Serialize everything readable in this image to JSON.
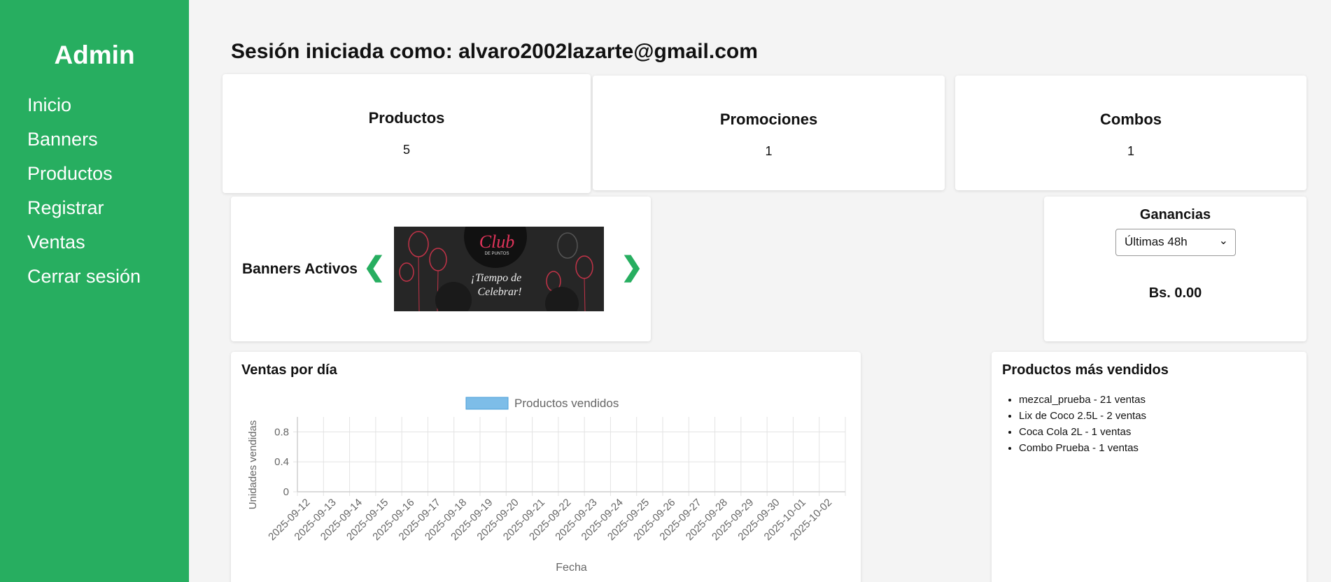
{
  "sidebar": {
    "brand": "Admin",
    "items": [
      {
        "label": "Inicio"
      },
      {
        "label": "Banners"
      },
      {
        "label": "Productos"
      },
      {
        "label": "Registrar"
      },
      {
        "label": "Ventas"
      },
      {
        "label": "Cerrar sesión"
      }
    ]
  },
  "header": {
    "title": "Sesión iniciada como: alvaro2002lazarte@gmail.com"
  },
  "stats": [
    {
      "title": "Productos",
      "value": "5"
    },
    {
      "title": "Promociones",
      "value": "1"
    },
    {
      "title": "Combos",
      "value": "1"
    }
  ],
  "banners": {
    "label": "Banners Activos",
    "prev_icon": "❮",
    "next_icon": "❯",
    "image": {
      "line1": "Club",
      "line2": "DE PUNTOS",
      "line3": "¡Tiempo de",
      "line4": "Celebrar!"
    }
  },
  "ganancias": {
    "title": "Ganancias",
    "selected": "Últimas 48h",
    "value": "Bs. 0.00"
  },
  "sales_chart": {
    "title": "Ventas por día"
  },
  "chart_data": {
    "type": "bar",
    "legend_position": "top",
    "xlabel": "Fecha",
    "ylabel": "Unidades vendidas",
    "ylim": [
      0,
      1
    ],
    "ytick_labels": [
      "0",
      "0.4",
      "0.8"
    ],
    "grid": true,
    "categories": [
      "2025-09-12",
      "2025-09-13",
      "2025-09-14",
      "2025-09-15",
      "2025-09-16",
      "2025-09-17",
      "2025-09-18",
      "2025-09-19",
      "2025-09-20",
      "2025-09-21",
      "2025-09-22",
      "2025-09-23",
      "2025-09-24",
      "2025-09-25",
      "2025-09-26",
      "2025-09-27",
      "2025-09-28",
      "2025-09-29",
      "2025-09-30",
      "2025-10-01",
      "2025-10-02"
    ],
    "series": [
      {
        "name": "Productos vendidos",
        "values": [
          0,
          0,
          0,
          0,
          0,
          0,
          0,
          0,
          0,
          0,
          0,
          0,
          0,
          0,
          0,
          0,
          0,
          0,
          0,
          0,
          0
        ]
      }
    ],
    "colors": {
      "fill": "#7dbde8",
      "border": "#4a9fd8"
    }
  },
  "top_products": {
    "title": "Productos más vendidos",
    "items": [
      "mezcal_prueba - 21 ventas",
      "Lix de Coco 2.5L - 2 ventas",
      "Coca Cola 2L - 1 ventas",
      "Combo Prueba - 1 ventas"
    ]
  },
  "colors": {
    "accent": "#27ae60",
    "background": "#f4f4f4"
  }
}
